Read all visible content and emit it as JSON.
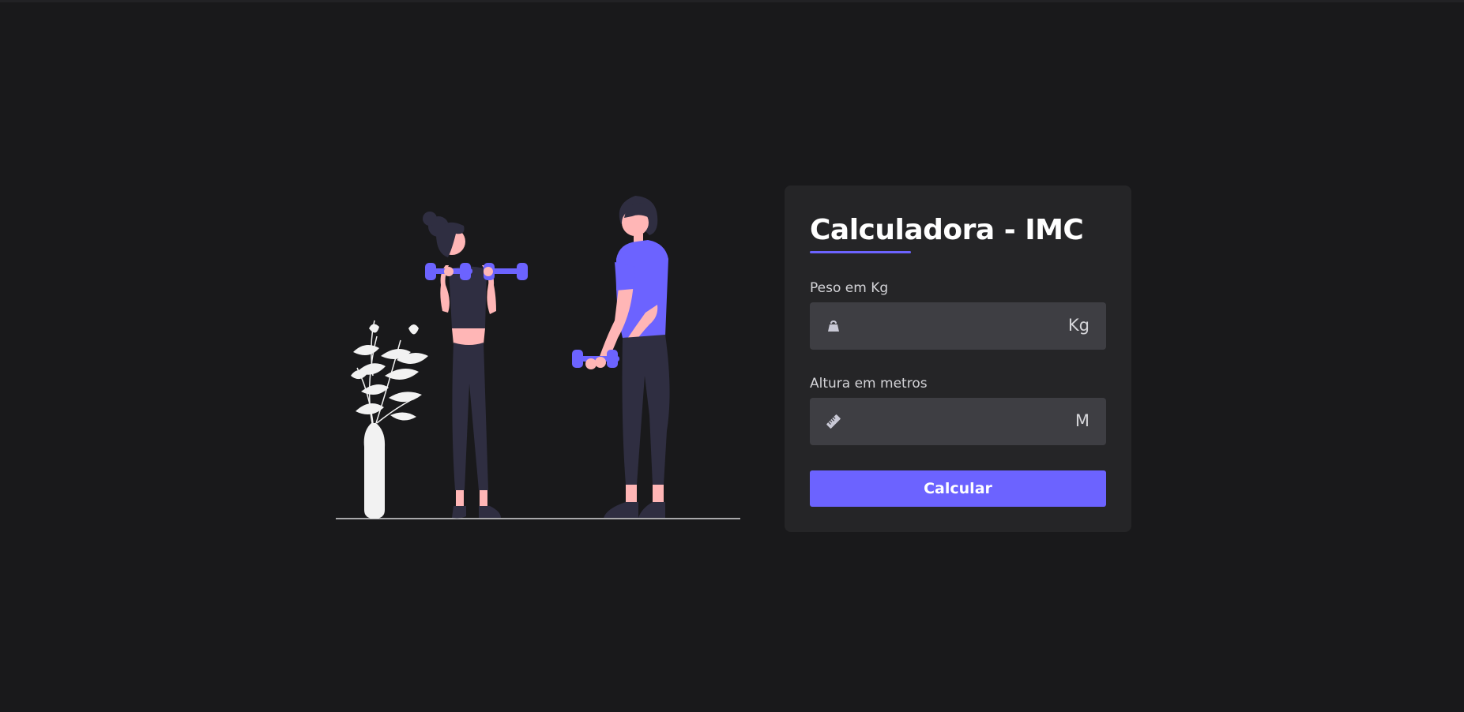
{
  "calculator": {
    "title": "Calculadora - IMC",
    "weight": {
      "label": "Peso em Kg",
      "value": "",
      "placeholder": "",
      "unit": "Kg",
      "icon": "weight-icon"
    },
    "height": {
      "label": "Altura em metros",
      "value": "",
      "placeholder": "",
      "unit": "M",
      "icon": "ruler-icon"
    },
    "button_label": "Calcular"
  },
  "colors": {
    "background": "#19191b",
    "card": "#252527",
    "input": "#3e3e43",
    "accent": "#6c63ff",
    "text": "#ffffff"
  }
}
